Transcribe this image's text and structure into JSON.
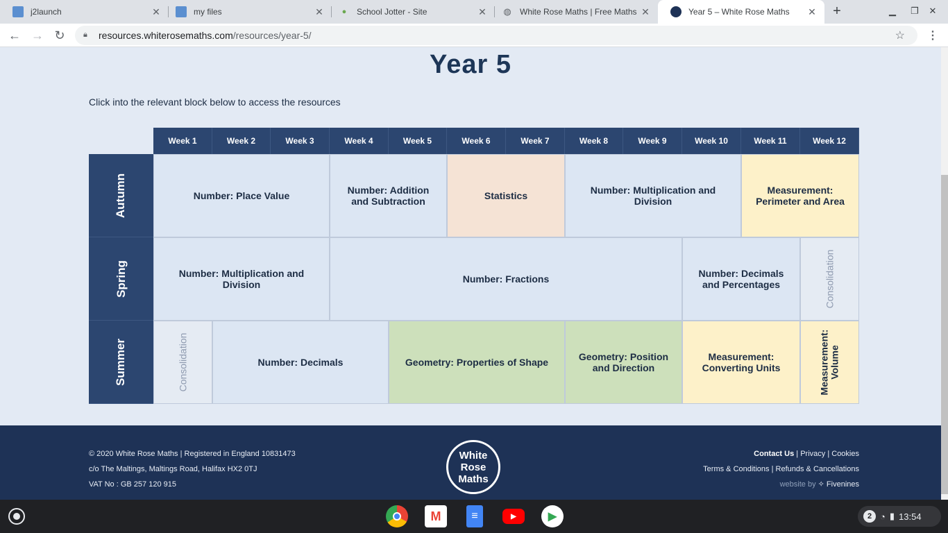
{
  "browser": {
    "tabs": [
      {
        "title": "j2launch",
        "favicon": "j2-icon"
      },
      {
        "title": "my files",
        "favicon": "j2-icon"
      },
      {
        "title": "School Jotter - Site",
        "favicon": "jotter-icon"
      },
      {
        "title": "White Rose Maths | Free Maths",
        "favicon": "globe-icon"
      },
      {
        "title": "Year 5 – White Rose Maths",
        "favicon": "wrm-icon",
        "active": true
      }
    ],
    "url_host": "resources.whiterosemaths.com",
    "url_path": "/resources/year-5/"
  },
  "page": {
    "title": "Year 5",
    "intro": "Click into the relevant block below to access the resources",
    "weeks": [
      "Week 1",
      "Week 2",
      "Week 3",
      "Week 4",
      "Week 5",
      "Week 6",
      "Week 7",
      "Week 8",
      "Week 9",
      "Week 10",
      "Week 11",
      "Week 12"
    ],
    "terms": [
      {
        "name": "Autumn",
        "blocks": [
          {
            "label": "Number: Place Value",
            "start": 1,
            "span": 3,
            "color": "#dce6f3"
          },
          {
            "label": "Number: Addition and Subtraction",
            "start": 4,
            "span": 2,
            "color": "#dce6f3"
          },
          {
            "label": "Statistics",
            "start": 6,
            "span": 2,
            "color": "#f5e3d5"
          },
          {
            "label": "Number: Multiplication and Division",
            "start": 8,
            "span": 3,
            "color": "#dce6f3"
          },
          {
            "label": "Measurement: Perimeter and Area",
            "start": 11,
            "span": 2,
            "color": "#fdf1c9"
          }
        ]
      },
      {
        "name": "Spring",
        "blocks": [
          {
            "label": "Number: Multiplication and Division",
            "start": 1,
            "span": 3,
            "color": "#dce6f3"
          },
          {
            "label": "Number: Fractions",
            "start": 4,
            "span": 6,
            "color": "#dce6f3"
          },
          {
            "label": "Number: Decimals and Percentages",
            "start": 10,
            "span": 2,
            "color": "#dce6f3"
          },
          {
            "label": "Consolidation",
            "start": 12,
            "span": 1,
            "color": "#e5ebf3",
            "vertical": true
          }
        ]
      },
      {
        "name": "Summer",
        "blocks": [
          {
            "label": "Consolidation",
            "start": 1,
            "span": 1,
            "color": "#e5ebf3",
            "vertical": true
          },
          {
            "label": "Number: Decimals",
            "start": 2,
            "span": 3,
            "color": "#dce6f3"
          },
          {
            "label": "Geometry: Properties of Shape",
            "start": 5,
            "span": 3,
            "color": "#cde0bb"
          },
          {
            "label": "Geometry: Position and Direction",
            "start": 8,
            "span": 2,
            "color": "#cde0bb"
          },
          {
            "label": "Measurement: Converting Units",
            "start": 10,
            "span": 2,
            "color": "#fdf1c9"
          },
          {
            "label": "Measurement: Volume",
            "start": 12,
            "span": 1,
            "color": "#fdf1c9",
            "vertical": true
          }
        ]
      }
    ]
  },
  "footer": {
    "line1": "© 2020 White Rose Maths | Registered in England 10831473",
    "line2": "c/o The Maltings, Maltings Road, Halifax HX2 0TJ",
    "line3": "VAT No : GB 257 120 915",
    "contact": "Contact Us",
    "privacy": "Privacy",
    "cookies": "Cookies",
    "terms": "Terms & Conditions",
    "refunds": "Refunds & Cancellations",
    "website_by": "website by",
    "agency": "Fivenines",
    "logo_lines": [
      "White",
      "Rose",
      "Maths"
    ]
  },
  "shelf": {
    "apps": [
      "chrome-icon",
      "gmail-icon",
      "docs-icon",
      "youtube-icon",
      "play-store-icon"
    ],
    "notification_count": "2",
    "time": "13:54"
  }
}
